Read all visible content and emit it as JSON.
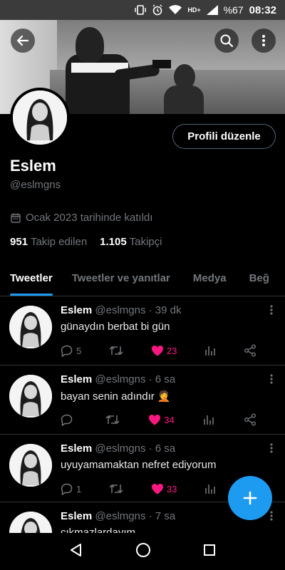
{
  "status_bar": {
    "hd": "HD+",
    "battery": "%67",
    "time": "08:32"
  },
  "profile": {
    "edit_label": "Profili düzenle",
    "name": "Eslem",
    "handle": "@eslmgns",
    "joined": "Ocak 2023 tarihinde katıldı",
    "following_count": "951",
    "following_label": "Takip edilen",
    "followers_count": "1.105",
    "followers_label": "Takipçi"
  },
  "tabs": [
    "Tweetler",
    "Tweetler ve yanıtlar",
    "Medya",
    "Beğ"
  ],
  "tweets": [
    {
      "name": "Eslem",
      "meta": "@eslmgns · 39 dk",
      "text": "günaydın berbat bi gün",
      "replies": "5",
      "likes": "23"
    },
    {
      "name": "Eslem",
      "meta": "@eslmgns · 6 sa",
      "text": "bayan senin adındır 🤦",
      "replies": "",
      "likes": "34"
    },
    {
      "name": "Eslem",
      "meta": "@eslmgns · 6 sa",
      "text": "uyuyamamaktan nefret ediyorum",
      "replies": "1",
      "likes": "33"
    },
    {
      "name": "Eslem",
      "meta": "@eslmgns · 7 sa",
      "text": "çıkmazlardayım",
      "replies": "",
      "likes": ""
    }
  ],
  "colors": {
    "accent": "#1d9bf0",
    "like": "#f91880",
    "muted": "#71767b"
  }
}
